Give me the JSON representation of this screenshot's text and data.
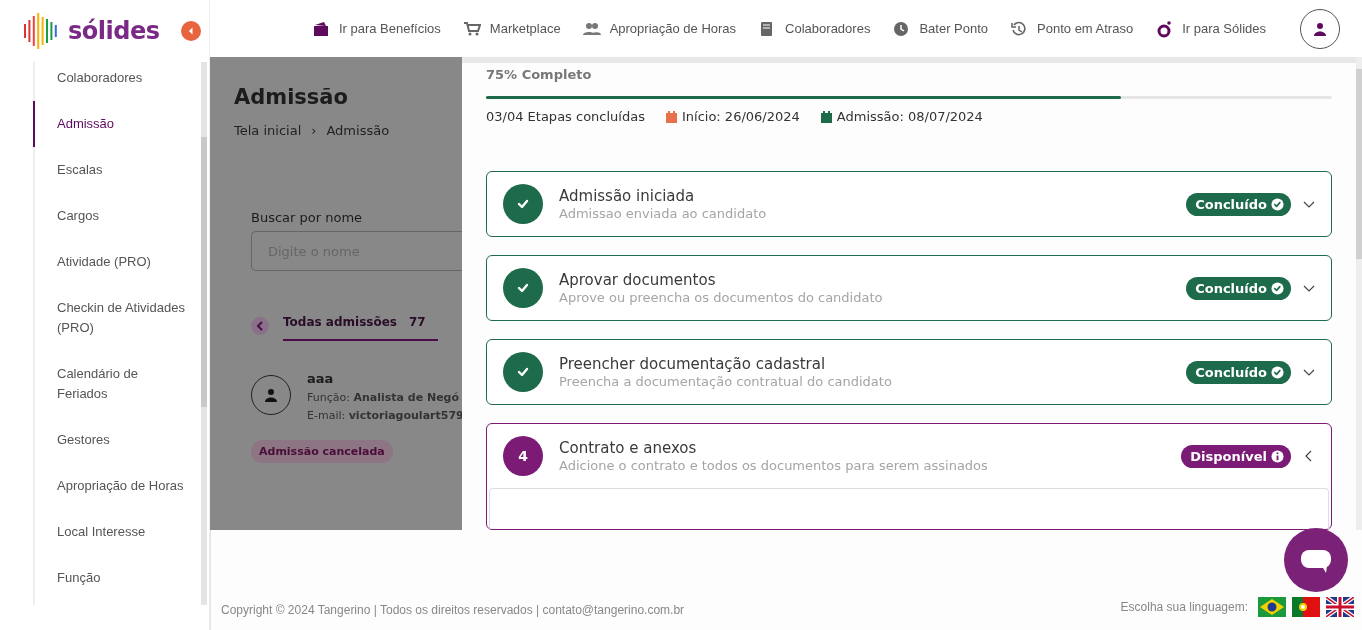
{
  "logo": {
    "text": "sólides"
  },
  "sidebar": {
    "items": [
      {
        "label": "Colaboradores",
        "selected": false
      },
      {
        "label": "Admissão",
        "selected": true
      },
      {
        "label": "Escalas",
        "selected": false
      },
      {
        "label": "Cargos",
        "selected": false
      },
      {
        "label": "Atividade (PRO)",
        "selected": false
      },
      {
        "label": "Checkin de Atividades (PRO)",
        "selected": false
      },
      {
        "label": "Calendário de Feriados",
        "selected": false
      },
      {
        "label": "Gestores",
        "selected": false
      },
      {
        "label": "Apropriação de Horas",
        "selected": false
      },
      {
        "label": "Local Interesse",
        "selected": false
      },
      {
        "label": "Função",
        "selected": false
      }
    ]
  },
  "topbar": {
    "links": [
      {
        "kind": "wallet",
        "label": "Ir para Benefícios"
      },
      {
        "kind": "cart",
        "label": "Marketplace"
      },
      {
        "kind": "people",
        "label": "Apropriação de Horas"
      },
      {
        "kind": "book",
        "label": "Colaboradores"
      },
      {
        "kind": "clock",
        "label": "Bater Ponto"
      },
      {
        "kind": "history",
        "label": "Ponto em Atraso"
      },
      {
        "kind": "brand",
        "label": "Ir para Sólides"
      }
    ]
  },
  "page": {
    "title": "Admissão",
    "breadcrumb": [
      "Tela inicial",
      "›",
      "Admissão"
    ],
    "search": {
      "label": "Buscar por nome",
      "placeholder": "Digite o nome"
    },
    "tab": {
      "label": "Todas admissões",
      "count": "77"
    },
    "card": {
      "name": "aaa",
      "role_label": "Função:",
      "role": "Analista de Negó",
      "email_label": "E-mail:",
      "email": "victoriagoulart579",
      "tag": "Admissão cancelada"
    }
  },
  "drawer": {
    "progress_label": "75% Completo",
    "level": 0.75,
    "steps_done": "03/04 Etapas concluídas",
    "dates": [
      {
        "label": "Início: 26/06/2024",
        "color": "#e8704a"
      },
      {
        "label": "Admissão: 08/07/2024",
        "color": "#1e6b4c"
      }
    ],
    "steps": [
      {
        "kind": "done",
        "title": "Admissão iniciada",
        "subtitle": "Admissao enviada ao candidato",
        "badge": "Concluído",
        "expanded": false
      },
      {
        "kind": "done",
        "title": "Aprovar documentos",
        "subtitle": "Aprove ou preencha os documentos do candidato",
        "badge": "Concluído",
        "expanded": false
      },
      {
        "kind": "done",
        "title": "Preencher documentação cadastral",
        "subtitle": "Preencha a documentação contratual do candidato",
        "badge": "Concluído",
        "expanded": false
      },
      {
        "kind": "available",
        "number": "4",
        "title": "Contrato e anexos",
        "subtitle": "Adicione o contrato e todos os documentos para serem assinados",
        "badge": "Disponível",
        "expanded": true
      }
    ]
  },
  "footer": {
    "copyright": "Copyright © 2024 Tangerino | Todos os direitos reservados | contato@tangerino.com.br",
    "language_label": "Escolha sua linguagem:",
    "flags": [
      {
        "kind": "br"
      },
      {
        "kind": "pt"
      },
      {
        "kind": "uk"
      }
    ]
  }
}
